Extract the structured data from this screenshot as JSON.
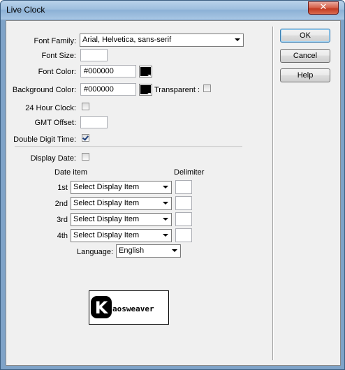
{
  "window": {
    "title": "Live Clock",
    "close_glyph": "✕"
  },
  "buttons": {
    "ok": "OK",
    "cancel": "Cancel",
    "help": "Help"
  },
  "form": {
    "font_family": {
      "label": "Font Family:",
      "value": "Arial, Helvetica, sans-serif"
    },
    "font_size": {
      "label": "Font Size:",
      "value": ""
    },
    "font_color": {
      "label": "Font Color:",
      "value": "#000000",
      "swatch": "#000000"
    },
    "background_color": {
      "label": "Background Color:",
      "value": "#000000",
      "swatch": "#000000",
      "transparent_label": "Transparent :",
      "transparent_checked": false
    },
    "hour24": {
      "label": "24 Hour Clock:",
      "checked": false
    },
    "gmt_offset": {
      "label": "GMT Offset:",
      "value": ""
    },
    "double_digit": {
      "label": "Double Digit Time:",
      "checked": true
    },
    "display_date": {
      "label": "Display Date:",
      "checked": false
    },
    "date_table": {
      "col_item": "Date item",
      "col_delimiter": "Delimiter",
      "rows": [
        {
          "label": "1st",
          "select": "Select Display Item",
          "delimiter": ""
        },
        {
          "label": "2nd",
          "select": "Select Display Item",
          "delimiter": ""
        },
        {
          "label": "3rd",
          "select": "Select Display Item",
          "delimiter": ""
        },
        {
          "label": "4th",
          "select": "Select Display Item",
          "delimiter": ""
        }
      ]
    },
    "language": {
      "label": "Language:",
      "value": "English"
    }
  },
  "logo": {
    "text": "aosweaver",
    "letter": "K"
  },
  "colors": {
    "title_bar": "#a9c7e4",
    "dialog_bg": "#f0f0f0",
    "close_button": "#c23a22"
  }
}
